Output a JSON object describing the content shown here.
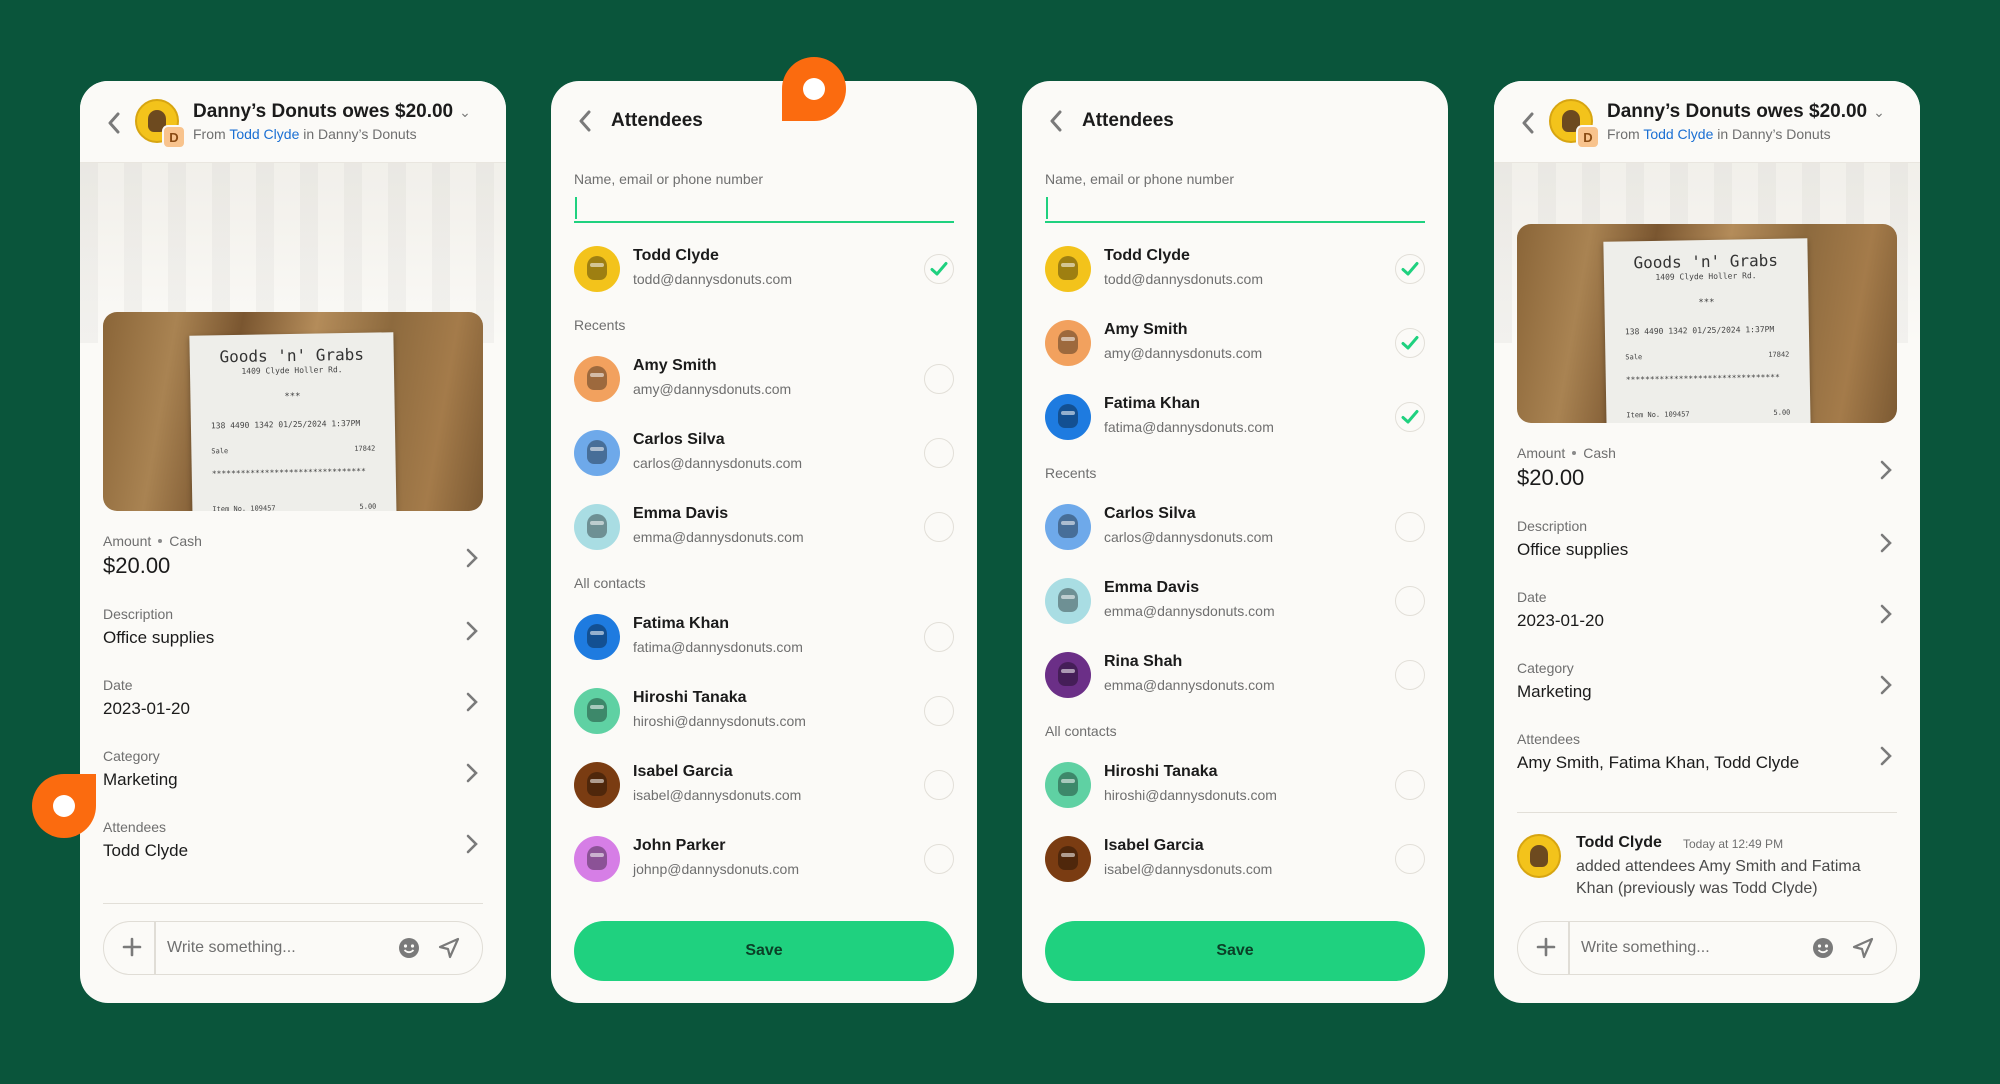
{
  "colors": {
    "background": "#0a553b",
    "accent_green": "#1fd17f",
    "marker_orange": "#fb6b0f",
    "link_blue": "#1a6fd3"
  },
  "expense": {
    "title": "Danny’s Donuts owes $20.00",
    "from_prefix": "From",
    "from_name": "Todd Clyde",
    "from_in": "in Danny’s Donuts",
    "org_badge": "D",
    "receipt": {
      "store": "Goods 'n' Grabs",
      "address": "1409 Clyde Holler Rd.",
      "stars": "***",
      "line1": "138 4490 1342 01/25/2024 1:37PM",
      "sale_label": "Sale",
      "sale_value": "17842",
      "dashes": "********************************",
      "item_label": "Item No. 109457",
      "item_value": "5.00"
    },
    "amount_label": "Amount",
    "amount_method": "Cash",
    "amount_value": "$20.00",
    "description_label": "Description",
    "description_value": "Office supplies",
    "date_label": "Date",
    "date_value": "2023-01-20",
    "category_label": "Category",
    "category_value": "Marketing",
    "attendees_label": "Attendees",
    "attendees_before": "Todd Clyde",
    "attendees_after": "Amy Smith, Fatima Khan, Todd Clyde",
    "composer_placeholder": "Write something..."
  },
  "activity": {
    "name": "Todd Clyde",
    "time": "Today at 12:49 PM",
    "text": "added attendees Amy Smith and Fatima Khan (previously was Todd Clyde)"
  },
  "attendees": {
    "title": "Attendees",
    "search_label": "Name, email or phone number",
    "recents_label": "Recents",
    "all_contacts_label": "All contacts",
    "save_label": "Save",
    "screen_a": {
      "selected": [
        {
          "name": "Todd Clyde",
          "email": "todd@dannysdonuts.com",
          "checked": true
        }
      ],
      "recents": [
        {
          "name": "Amy Smith",
          "email": "amy@dannysdonuts.com",
          "checked": false
        },
        {
          "name": "Carlos Silva",
          "email": "carlos@dannysdonuts.com",
          "checked": false
        },
        {
          "name": "Emma Davis",
          "email": "emma@dannysdonuts.com",
          "checked": false
        }
      ],
      "all": [
        {
          "name": "Fatima Khan",
          "email": "fatima@dannysdonuts.com",
          "checked": false
        },
        {
          "name": "Hiroshi Tanaka",
          "email": "hiroshi@dannysdonuts.com",
          "checked": false
        },
        {
          "name": "Isabel Garcia",
          "email": "isabel@dannysdonuts.com",
          "checked": false
        },
        {
          "name": "John Parker",
          "email": "johnp@dannysdonuts.com",
          "checked": false
        }
      ]
    },
    "screen_b": {
      "selected": [
        {
          "name": "Todd Clyde",
          "email": "todd@dannysdonuts.com",
          "checked": true
        },
        {
          "name": "Amy Smith",
          "email": "amy@dannysdonuts.com",
          "checked": true
        },
        {
          "name": "Fatima Khan",
          "email": "fatima@dannysdonuts.com",
          "checked": true
        }
      ],
      "recents": [
        {
          "name": "Carlos Silva",
          "email": "carlos@dannysdonuts.com",
          "checked": false
        },
        {
          "name": "Emma Davis",
          "email": "emma@dannysdonuts.com",
          "checked": false
        },
        {
          "name": "Rina Shah",
          "email": "emma@dannysdonuts.com",
          "checked": false
        }
      ],
      "all": [
        {
          "name": "Hiroshi Tanaka",
          "email": "hiroshi@dannysdonuts.com",
          "checked": false
        },
        {
          "name": "Isabel Garcia",
          "email": "isabel@dannysdonuts.com",
          "checked": false
        }
      ]
    }
  },
  "avatar_colors": {
    "Todd Clyde": "#f3c31b",
    "Amy Smith": "#f2a15e",
    "Carlos Silva": "#6ea9ea",
    "Emma Davis": "#a9dde3",
    "Fatima Khan": "#1e7be0",
    "Hiroshi Tanaka": "#5fd1a3",
    "Isabel Garcia": "#7a3c12",
    "John Parker": "#d67ee6",
    "Rina Shah": "#6b2f87"
  }
}
